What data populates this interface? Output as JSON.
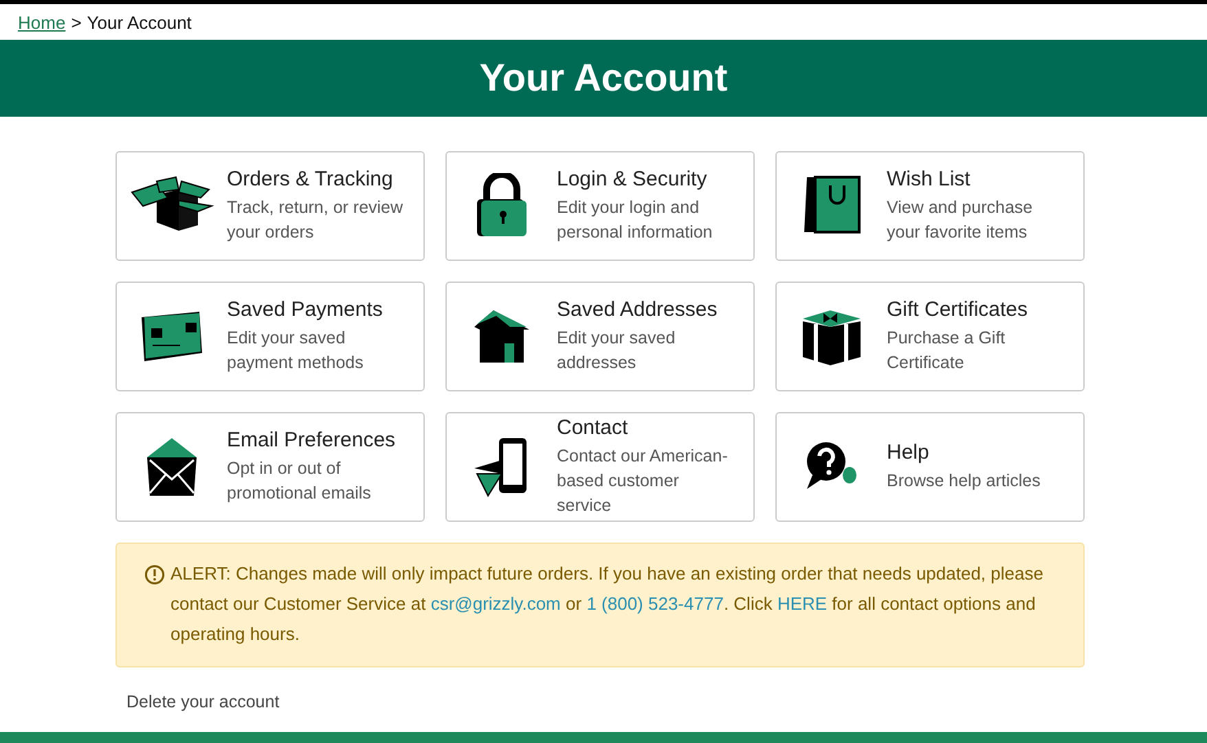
{
  "breadcrumb": {
    "link": "Home",
    "separator": ">",
    "current": "Your Account"
  },
  "header": {
    "title": "Your Account"
  },
  "cards": [
    {
      "kind": "box",
      "title": "Orders & Tracking",
      "description": "Track, return, or review your orders"
    },
    {
      "kind": "lock",
      "title": "Login & Security",
      "description": "Edit your login and personal information"
    },
    {
      "kind": "bag",
      "title": "Wish List",
      "description": "View and purchase your favorite items"
    },
    {
      "kind": "card",
      "title": "Saved Payments",
      "description": "Edit your saved payment methods"
    },
    {
      "kind": "house",
      "title": "Saved Addresses",
      "description": "Edit your saved addresses"
    },
    {
      "kind": "gift",
      "title": "Gift Certificates",
      "description": "Purchase a Gift Certificate"
    },
    {
      "kind": "envelope",
      "title": "Email Preferences",
      "description": "Opt in or out of promotional emails"
    },
    {
      "kind": "phone",
      "title": "Contact",
      "description": "Contact our American-based customer service"
    },
    {
      "kind": "help",
      "title": "Help",
      "description": "Browse help articles"
    }
  ],
  "alert": {
    "segments": [
      {
        "kind": "text",
        "text": "ALERT: Changes made will only impact future orders. If you have an existing order that needs updated, please contact our Customer Service at "
      },
      {
        "kind": "link",
        "text": "csr@grizzly.com"
      },
      {
        "kind": "text",
        "text": " or "
      },
      {
        "kind": "link",
        "text": "1 (800) 523-4777"
      },
      {
        "kind": "text",
        "text": ". Click "
      },
      {
        "kind": "link",
        "text": "HERE"
      },
      {
        "kind": "text",
        "text": " for all contact options and operating hours."
      }
    ]
  },
  "delete_link": "Delete your account"
}
